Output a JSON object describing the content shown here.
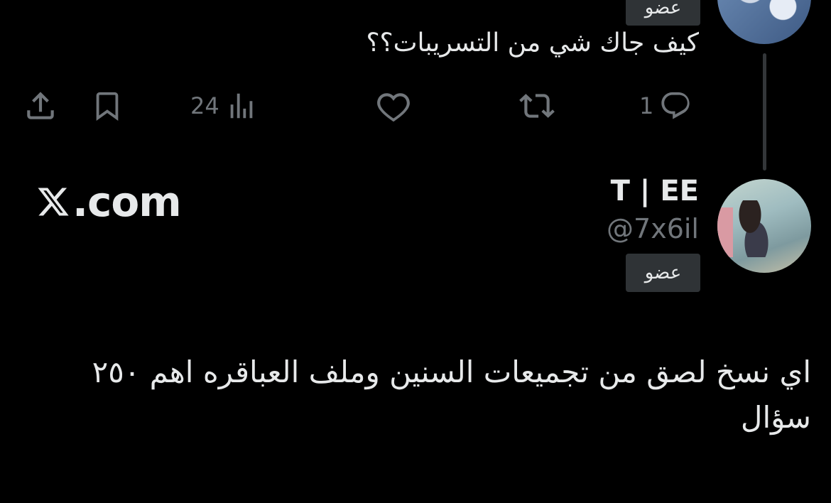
{
  "previous_tweet": {
    "badge": "عضو",
    "text": "كيف جاك شي من التسريبات؟؟",
    "actions": {
      "reply_count": "1",
      "retweet_count": "",
      "like_count": "",
      "views_count": "24"
    },
    "icons": [
      "reply-icon",
      "retweet-icon",
      "like-icon",
      "views-icon",
      "bookmark-icon",
      "share-icon"
    ]
  },
  "tweet": {
    "display_name": "T | EE",
    "handle": "@7x6il",
    "badge": "عضو",
    "text": "اي نسخ لصق من تجميعات السنين وملف العباقره اهم ٢٥٠ سؤال"
  },
  "watermark": {
    "text": ".com"
  },
  "colors": {
    "background": "#000000",
    "text": "#e7e9ea",
    "muted": "#71767b",
    "badge_bg": "#2f3336",
    "thread_line": "#333639"
  }
}
